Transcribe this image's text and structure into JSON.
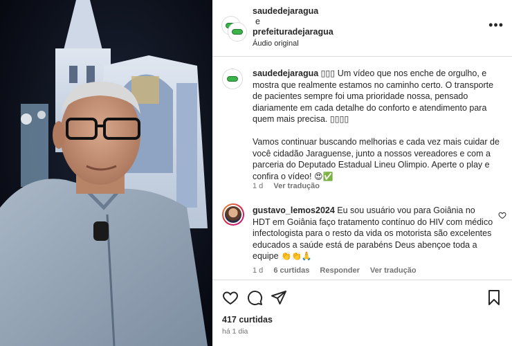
{
  "header": {
    "account_1": "saudedejaragua",
    "conjunction": "e",
    "account_2": "prefeituradejaragua",
    "audio": "Áudio original",
    "more_icon": "more-horizontal-icon"
  },
  "caption": {
    "username": "saudedejaragua",
    "lead_marks": "▯▯▯",
    "paragraph_1": "Um vídeo que nos enche de orgulho, e mostra que realmente estamos no caminho certo. O transporte de pacientes sempre foi uma prioridade nossa, pensado diariamente em cada detalhe do conforto e atendimento para quem mais precisa.",
    "paragraph_1_marks": "▯▯▯▯",
    "paragraph_2": "Vamos continuar buscando melhorias e cada vez mais cuidar de você cidadão Jaraguense, junto a nossos vereadores e com a parceria do Deputado Estadual Lineu Olimpio. Aperte o play e confira o vídeo!",
    "paragraph_2_emojis": "😍✅",
    "age": "1 d",
    "translate": "Ver tradução"
  },
  "comment": {
    "username": "gustavo_lemos2024",
    "text": "Eu sou usuário vou para Goiânia no HDT em Goiânia faço tratamento contínuo do HIV com médico infectologista para o resto da vida os motorista são excelentes educados a saúde está de parabéns Deus abençoe toda a equipe",
    "emojis": "👏👏🙏",
    "age": "1 d",
    "likes": "6 curtidas",
    "reply": "Responder",
    "translate": "Ver tradução"
  },
  "footer": {
    "likes": "417 curtidas",
    "time": "há 1 dia"
  },
  "colors": {
    "text": "#262626",
    "muted": "#737373",
    "border": "#dbdbdb",
    "logo_green": "#3bb34a"
  }
}
